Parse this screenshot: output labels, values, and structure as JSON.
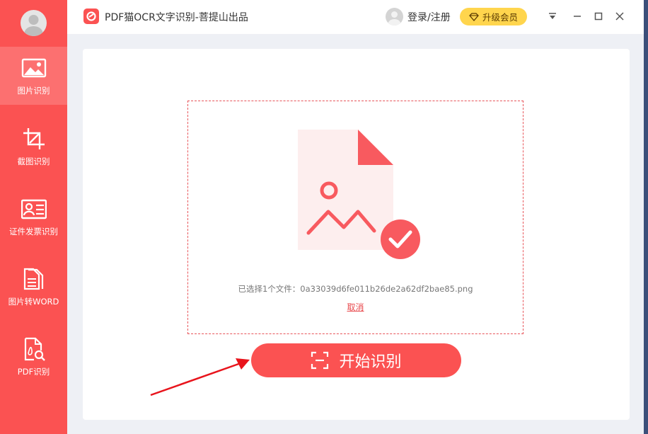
{
  "window": {
    "title": "PDF猫OCR文字识别-菩提山出品",
    "login_label": "登录/注册",
    "upgrade_label": "升级会员"
  },
  "sidebar": {
    "items": [
      {
        "label": "图片识别",
        "icon": "image-icon",
        "active": true
      },
      {
        "label": "截图识别",
        "icon": "crop-icon",
        "active": false
      },
      {
        "label": "证件发票识别",
        "icon": "id-card-icon",
        "active": false
      },
      {
        "label": "图片转WORD",
        "icon": "document-icon",
        "active": false
      },
      {
        "label": "PDF识别",
        "icon": "pdf-search-icon",
        "active": false
      }
    ]
  },
  "main": {
    "selected_file_text": "已选择1个文件：0a33039d6fe011b26de2a62df2bae85.png",
    "cancel_label": "取消",
    "start_button_label": "开始识别"
  },
  "colors": {
    "accent": "#fb5252",
    "vip": "#ffd54d"
  }
}
